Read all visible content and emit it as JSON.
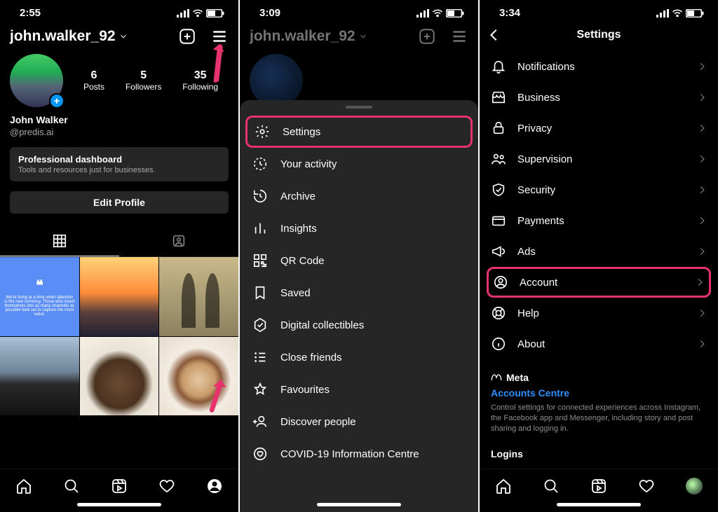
{
  "phone1": {
    "time": "2:55",
    "username": "john.walker_92",
    "stats": {
      "posts_num": "6",
      "posts_label": "Posts",
      "followers_num": "5",
      "followers_label": "Followers",
      "following_num": "35",
      "following_label": "Following"
    },
    "display_name": "John Walker",
    "handle": "@predis.ai",
    "pro_dash_title": "Professional dashboard",
    "pro_dash_sub": "Tools and resources just for businesses.",
    "edit_profile": "Edit Profile",
    "quote_text": "We're living at a time when attention is the new currency. Those who insert themselves into as many channels as possible look set to capture the most value."
  },
  "phone2": {
    "time": "3:09",
    "username": "john.walker_92",
    "menu": {
      "settings": "Settings",
      "activity": "Your activity",
      "archive": "Archive",
      "insights": "Insights",
      "qr": "QR Code",
      "saved": "Saved",
      "collectibles": "Digital collectibles",
      "close_friends": "Close friends",
      "favourites": "Favourites",
      "discover": "Discover people",
      "covid": "COVID-19 Information Centre"
    }
  },
  "phone3": {
    "time": "3:34",
    "title": "Settings",
    "items": {
      "notifications": "Notifications",
      "business": "Business",
      "privacy": "Privacy",
      "supervision": "Supervision",
      "security": "Security",
      "payments": "Payments",
      "ads": "Ads",
      "account": "Account",
      "help": "Help",
      "about": "About"
    },
    "meta_brand": "Meta",
    "accounts_centre": "Accounts Centre",
    "meta_desc": "Control settings for connected experiences across Instagram, the Facebook app and Messenger, including story and post sharing and logging in.",
    "logins": "Logins"
  }
}
